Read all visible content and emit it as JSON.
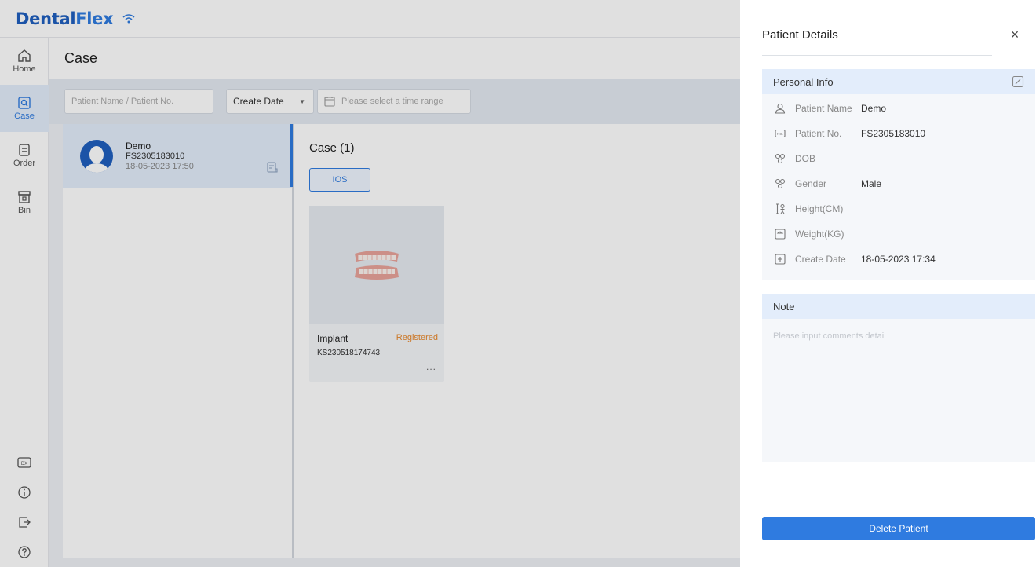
{
  "app": {
    "logo_part1": "Dental",
    "logo_part2": "Flex"
  },
  "sidebar": {
    "items": [
      {
        "label": "Home",
        "icon": "home-icon"
      },
      {
        "label": "Case",
        "icon": "case-icon"
      },
      {
        "label": "Order",
        "icon": "order-icon"
      },
      {
        "label": "Bin",
        "icon": "bin-icon"
      }
    ],
    "bottom_icons": [
      "dx-icon",
      "info-icon",
      "logout-icon",
      "help-icon"
    ]
  },
  "header": {
    "title": "Case"
  },
  "filters": {
    "search_placeholder": "Patient Name / Patient No.",
    "date_select": "Create Date",
    "date_range_placeholder": "Please select a time range"
  },
  "patients": [
    {
      "name": "Demo",
      "no": "FS2305183010",
      "date": "18-05-2023 17:50"
    }
  ],
  "cases": {
    "title": "Case (1)",
    "tab": "IOS",
    "items": [
      {
        "type": "Implant",
        "status": "Registered",
        "no": "KS230518174743",
        "more": "..."
      }
    ]
  },
  "drawer": {
    "title": "Patient Details",
    "close": "×",
    "personal_info_title": "Personal Info",
    "fields": [
      {
        "label": "Patient Name",
        "value": "Demo",
        "icon": "user-icon"
      },
      {
        "label": "Patient No.",
        "value": "FS2305183010",
        "icon": "number-icon"
      },
      {
        "label": "DOB",
        "value": "",
        "icon": "dob-icon"
      },
      {
        "label": "Gender",
        "value": "Male",
        "icon": "gender-icon"
      },
      {
        "label": "Height(CM)",
        "value": "",
        "icon": "height-icon"
      },
      {
        "label": "Weight(KG)",
        "value": "",
        "icon": "weight-icon"
      },
      {
        "label": "Create Date",
        "value": "18-05-2023 17:34",
        "icon": "calendar-plus-icon"
      }
    ],
    "note_title": "Note",
    "note_placeholder": "Please input comments detail",
    "delete_label": "Delete Patient"
  },
  "colors": {
    "primary": "#2f7be0",
    "brand": "#1f5fbf",
    "status_registered": "#e8892e"
  }
}
